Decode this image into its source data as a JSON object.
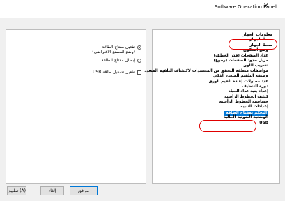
{
  "window": {
    "title": "Software Operation Panel",
    "close_glyph": "✕"
  },
  "options": {
    "radio_on": "تفعيل مفتاح الطاقة",
    "radio_on_sub": "(وضع المصنع الافتراضي)",
    "radio_off": "إبطال مفتاح الطاقة",
    "usb_checkbox": "تفعيل تشغيل طاقة USB"
  },
  "tree": {
    "items": [
      "معلومات الجهاز",
      "ضبط الجهاز",
      "ضبط الجهاز",
      "وضع السكون",
      "عداد الصفحات (قدر الخطف)",
      "مزيل حدود الصفحات (رجوع)",
      "تسريب اللون",
      "مواصفات منطقة التحقق من المستندات لاكتشاف التلقيم المتعدد",
      "وظيفة التلقيم المتعدد الذكي",
      "عدد محاولات إعادة تلقيم الورق",
      "دورة التنظيف",
      "إعداد بنية عداد الحياة",
      "كشف الخطوط الرأسية",
      "حساسية الخطوط الرأسية",
      "إعدادات التنبيه",
      "التحكم بمفتاح الطاقة",
      "الوضعية الضوئية الحالية",
      "USB"
    ]
  },
  "buttons": {
    "ok": "موافق",
    "cancel": "إلغاء",
    "apply": "تطبيق (A)"
  },
  "colors": {
    "highlight": "#0078d7",
    "annotation": "#e00000"
  }
}
